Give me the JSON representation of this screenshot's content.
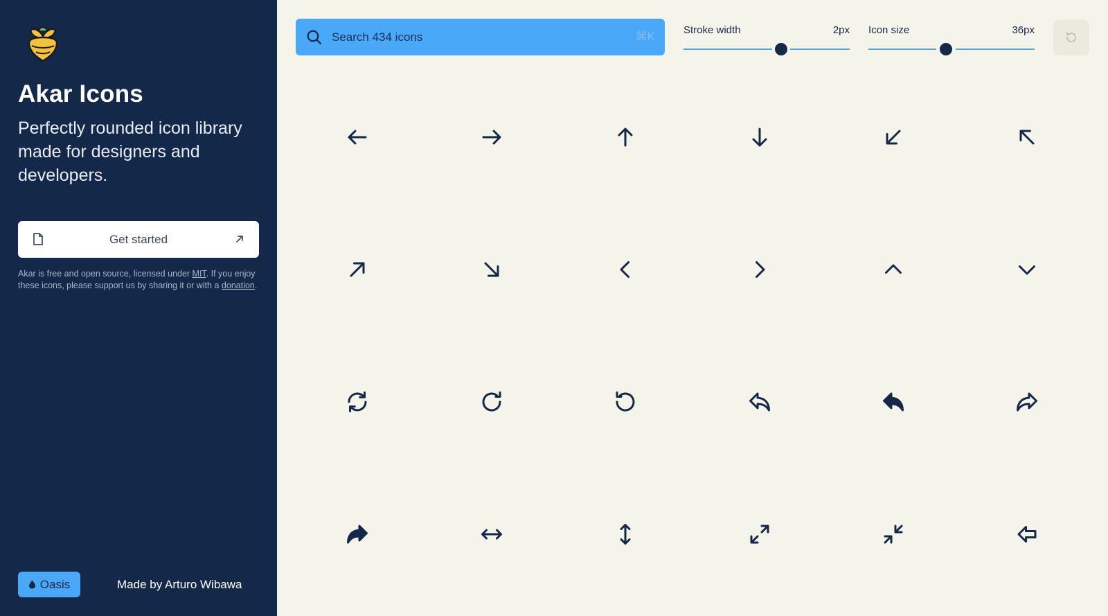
{
  "sidebar": {
    "title": "Akar Icons",
    "tagline": "Perfectly rounded icon library made for designers and developers.",
    "get_started_label": "Get started",
    "license_text_1": "Akar is free and open source, licensed under ",
    "license_link": "MIT",
    "license_text_2": ". If you enjoy these icons, please support us by sharing it or with a ",
    "donation_link": "donation",
    "license_text_3": ".",
    "theme_label": "Oasis",
    "credit": "Made by Arturo Wibawa"
  },
  "toolbar": {
    "search_placeholder": "Search 434 icons",
    "search_shortcut": "⌘K",
    "stroke_label": "Stroke width",
    "stroke_value": "2px",
    "stroke_level": 0.59,
    "size_label": "Icon size",
    "size_value": "36px",
    "size_level": 0.47
  },
  "colors": {
    "sidebar_bg": "#142849",
    "accent": "#4aa8f8",
    "content_bg": "#f5f4ea",
    "icon_stroke": "#142849"
  },
  "icons": [
    "arrow-left",
    "arrow-right",
    "arrow-up",
    "arrow-down",
    "arrow-down-left",
    "arrow-up-left",
    "arrow-up-right",
    "arrow-down-right",
    "chevron-left",
    "chevron-right",
    "chevron-up",
    "chevron-down",
    "arrow-cycle",
    "arrow-clockwise",
    "arrow-counter-clockwise",
    "arrow-back",
    "arrow-back-thick-fill",
    "arrow-forward",
    "arrow-forward-thick-fill",
    "arrow-left-right",
    "arrow-up-down",
    "enlarge",
    "reduce",
    "arrow-back-thick"
  ]
}
